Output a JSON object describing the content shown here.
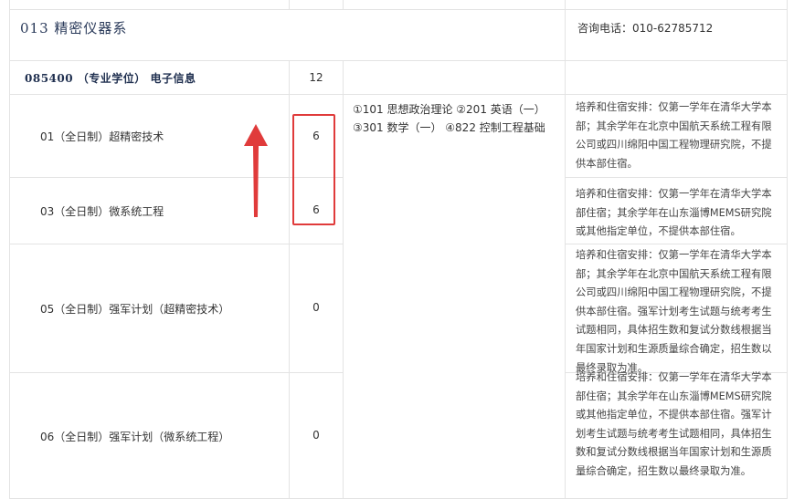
{
  "department": {
    "code_name": "013 精密仪器系",
    "phone": "咨询电话：010-62785712"
  },
  "major": {
    "title": "085400 （专业学位） 电子信息",
    "quota": "12"
  },
  "exam_subjects": {
    "line1": "①101 思想政治理论 ②201 英语（一）",
    "line2": "③301 数学（一） ④822 控制工程基础"
  },
  "directions": [
    {
      "name": "01（全日制）超精密技术",
      "quota": "6",
      "note": "培养和住宿安排：仅第一学年在清华大学本部；其余学年在北京中国航天系统工程有限公司或四川绵阳中国工程物理研究院，不提供本部住宿。"
    },
    {
      "name": "03（全日制）微系统工程",
      "quota": "6",
      "note": "培养和住宿安排：仅第一学年在清华大学本部住宿；其余学年在山东淄博MEMS研究院或其他指定单位，不提供本部住宿。"
    },
    {
      "name": "05（全日制）强军计划（超精密技术）",
      "quota": "0",
      "note": "培养和住宿安排：仅第一学年在清华大学本部；其余学年在北京中国航天系统工程有限公司或四川绵阳中国工程物理研究院，不提供本部住宿。强军计划考生试题与统考考生试题相同，具体招生数和复试分数线根据当年国家计划和生源质量综合确定，招生数以最终录取为准。"
    },
    {
      "name": "06（全日制）强军计划（微系统工程）",
      "quota": "0",
      "note": "培养和住宿安排：仅第一学年在清华大学本部住宿；其余学年在山东淄博MEMS研究院或其他指定单位，不提供本部住宿。强军计划考生试题与统考考生试题相同，具体招生数和复试分数线根据当年国家计划和生源质量综合确定，招生数以最终录取为准。"
    }
  ],
  "annotation": {
    "box_color": "#e03b3b",
    "arrow_color": "#e03b3b"
  }
}
